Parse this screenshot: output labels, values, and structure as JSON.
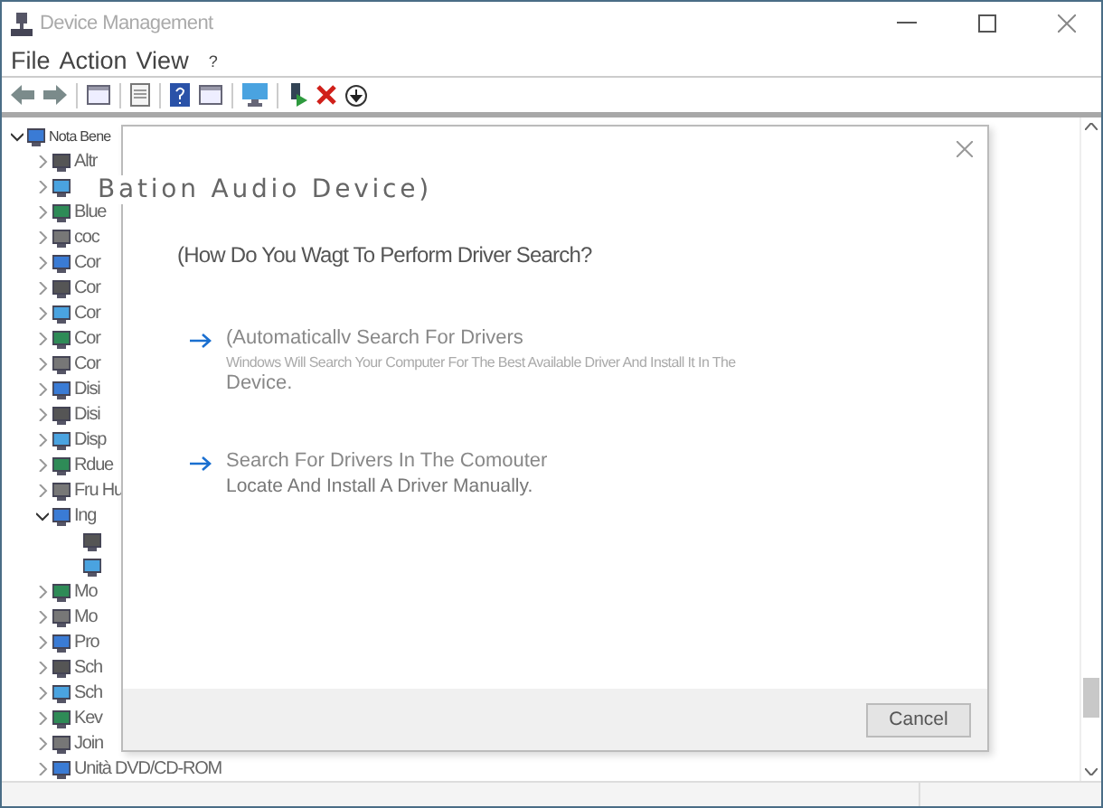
{
  "window": {
    "title": "Device Management"
  },
  "menu": [
    {
      "label": "File"
    },
    {
      "label": "Action"
    },
    {
      "label": "View"
    },
    {
      "label": "?"
    }
  ],
  "tree": {
    "label": "Nota Bene",
    "expanded": true,
    "children": [
      {
        "kind": "branch",
        "expanded": false,
        "label": "Altr"
      },
      {
        "kind": "branch",
        "expanded": false
      },
      {
        "kind": "branch",
        "expanded": false,
        "label": "Blue"
      },
      {
        "kind": "branch",
        "expanded": false,
        "label": "coc"
      },
      {
        "kind": "branch",
        "expanded": false,
        "label": "Cor"
      },
      {
        "kind": "branch",
        "expanded": false,
        "label": "Cor"
      },
      {
        "kind": "branch",
        "expanded": false,
        "label": "Cor"
      },
      {
        "kind": "branch",
        "expanded": false,
        "label": "Cor"
      },
      {
        "kind": "branch",
        "expanded": false,
        "label": "Cor"
      },
      {
        "kind": "branch",
        "expanded": false,
        "label": "Disi"
      },
      {
        "kind": "branch",
        "expanded": false,
        "label": "Disi"
      },
      {
        "kind": "branch",
        "expanded": false,
        "label": "Disp"
      },
      {
        "kind": "branch",
        "expanded": false,
        "label": "Rdue"
      },
      {
        "kind": "branch",
        "expanded": false,
        "label": "Fru Hu"
      },
      {
        "kind": "branch",
        "expanded": true,
        "label": "Ing",
        "children": [
          {
            "kind": "leaf"
          },
          {
            "kind": "leaf"
          }
        ]
      },
      {
        "kind": "branch",
        "expanded": false,
        "label": "Mo"
      },
      {
        "kind": "branch",
        "expanded": false,
        "label": "Mo"
      },
      {
        "kind": "branch",
        "expanded": false,
        "label": "Pro"
      },
      {
        "kind": "branch",
        "expanded": false,
        "label": "Sch"
      },
      {
        "kind": "branch",
        "expanded": false,
        "label": "Sch"
      },
      {
        "kind": "branch",
        "expanded": false,
        "label": "Kev"
      },
      {
        "kind": "branch",
        "expanded": false,
        "label": "Join"
      },
      {
        "kind": "branch",
        "expanded": false,
        "label": "Unità DVD/CD-ROM"
      }
    ]
  },
  "dialog": {
    "title": "Bation Audio Device)",
    "question": "(How Do You Wagt To Perform Driver Search?",
    "options": [
      {
        "title": "(Automaticallv Search For Drivers",
        "description": "Windows Will Search Your Computer For The Best Available Driver And Install It In The",
        "description_2": "Device."
      },
      {
        "title": "Search For Drivers In The Comouter",
        "description_2": "Locate And Install A Driver Manually."
      }
    ],
    "cancel": "Cancel"
  }
}
